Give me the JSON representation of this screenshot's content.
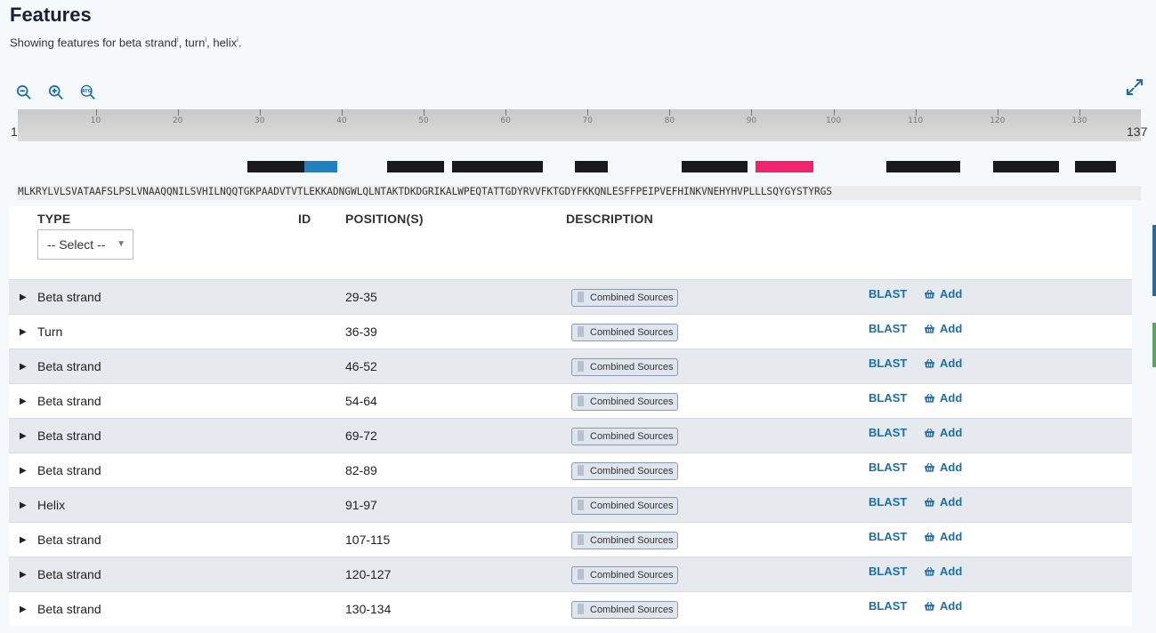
{
  "header": {
    "title": "Features",
    "subtitle_prefix": "Showing features for ",
    "subtitle_items": [
      "beta strand",
      "turn",
      "helix"
    ],
    "info_mark": "i"
  },
  "toolbar": {
    "zoom_out_icon": "zoom-out-icon",
    "zoom_in_icon": "zoom-in-icon",
    "sequence_icon": "atg-sequence-icon",
    "expand_icon": "expand-icon"
  },
  "ruler": {
    "start": "1",
    "end": "137",
    "tick_labels": [
      "10",
      "20",
      "30",
      "40",
      "50",
      "60",
      "70",
      "80",
      "90",
      "100",
      "110",
      "120",
      "130"
    ],
    "length": 137
  },
  "sequence": "MLKRYLVLSVATAAFSLPSLVNAAQQNILSVHILNQQTGKPAADVTVTLEKKADNGWLQLNTAKTDKDGRIKALWPEQTATTGDYRVVFKTGDYFKKQNLESFFPEIPVEFHINKVNEHYHVPLLLSQYGYSTYRGS",
  "colors": {
    "beta_strand": "#1a1a1a",
    "turn": "#1f82c0",
    "helix": "#f0246e",
    "link": "#1a6fa8"
  },
  "table": {
    "headers": {
      "type": "TYPE",
      "id": "ID",
      "positions": "POSITION(S)",
      "description": "DESCRIPTION"
    },
    "type_filter": "-- Select --",
    "rows": [
      {
        "type": "Beta strand",
        "positions": "29-35",
        "start": 29,
        "end": 35,
        "kind": "beta_strand",
        "source": "Combined Sources",
        "blast": "BLAST",
        "add": "Add"
      },
      {
        "type": "Turn",
        "positions": "36-39",
        "start": 36,
        "end": 39,
        "kind": "turn",
        "source": "Combined Sources",
        "blast": "BLAST",
        "add": "Add"
      },
      {
        "type": "Beta strand",
        "positions": "46-52",
        "start": 46,
        "end": 52,
        "kind": "beta_strand",
        "source": "Combined Sources",
        "blast": "BLAST",
        "add": "Add"
      },
      {
        "type": "Beta strand",
        "positions": "54-64",
        "start": 54,
        "end": 64,
        "kind": "beta_strand",
        "source": "Combined Sources",
        "blast": "BLAST",
        "add": "Add"
      },
      {
        "type": "Beta strand",
        "positions": "69-72",
        "start": 69,
        "end": 72,
        "kind": "beta_strand",
        "source": "Combined Sources",
        "blast": "BLAST",
        "add": "Add"
      },
      {
        "type": "Beta strand",
        "positions": "82-89",
        "start": 82,
        "end": 89,
        "kind": "beta_strand",
        "source": "Combined Sources",
        "blast": "BLAST",
        "add": "Add"
      },
      {
        "type": "Helix",
        "positions": "91-97",
        "start": 91,
        "end": 97,
        "kind": "helix",
        "source": "Combined Sources",
        "blast": "BLAST",
        "add": "Add"
      },
      {
        "type": "Beta strand",
        "positions": "107-115",
        "start": 107,
        "end": 115,
        "kind": "beta_strand",
        "source": "Combined Sources",
        "blast": "BLAST",
        "add": "Add"
      },
      {
        "type": "Beta strand",
        "positions": "120-127",
        "start": 120,
        "end": 127,
        "kind": "beta_strand",
        "source": "Combined Sources",
        "blast": "BLAST",
        "add": "Add"
      },
      {
        "type": "Beta strand",
        "positions": "130-134",
        "start": 130,
        "end": 134,
        "kind": "beta_strand",
        "source": "Combined Sources",
        "blast": "BLAST",
        "add": "Add"
      }
    ]
  }
}
